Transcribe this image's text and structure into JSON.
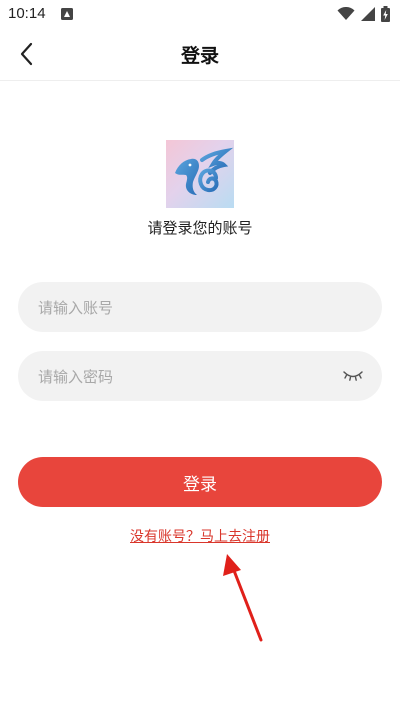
{
  "status_bar": {
    "time": "10:14"
  },
  "header": {
    "title": "登录"
  },
  "login": {
    "prompt": "请登录您的账号",
    "account_placeholder": "请输入账号",
    "password_placeholder": "请输入密码",
    "submit_label": "登录",
    "register_link": "没有账号？马上去注册"
  },
  "icons": {
    "back": "chevron-left-icon",
    "password_toggle": "eye-closed-icon",
    "wifi": "wifi-icon",
    "signal": "signal-icon",
    "battery": "battery-charging-icon",
    "notification": "notification-icon",
    "logo": "app-logo"
  },
  "colors": {
    "primary": "#e8453c",
    "link": "#d9362b",
    "input_bg": "#f2f2f2",
    "placeholder": "#a8a8a8"
  }
}
